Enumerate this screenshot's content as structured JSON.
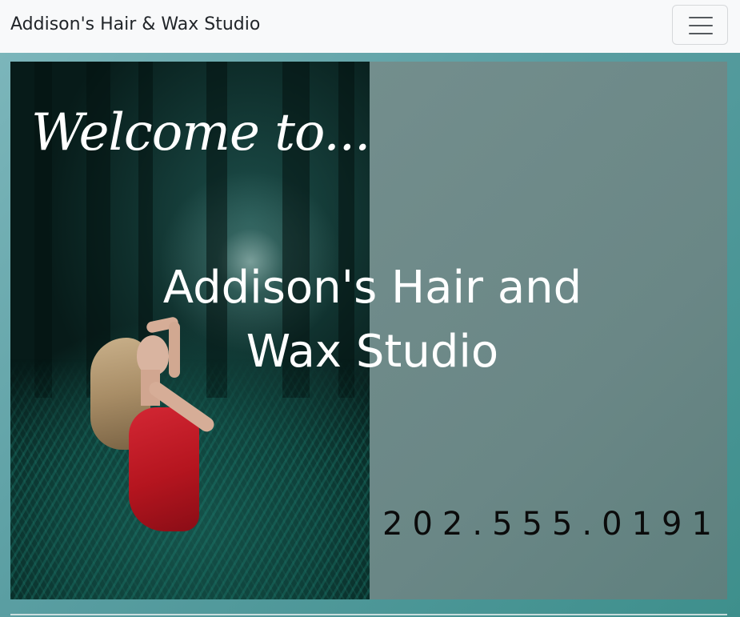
{
  "navbar": {
    "brand": "Addison's Hair & Wax Studio",
    "toggler_icon": "hamburger-menu-icon"
  },
  "hero": {
    "welcome": "Welcome to...",
    "title": "Addison's Hair and Wax Studio",
    "phone": "202.555.0191",
    "photo_description_icon": "woman-in-forest-photo"
  },
  "colors": {
    "navbar_bg": "#f8f9fa",
    "page_bg": "#5a9ea2",
    "overlay_bg": "#6e8a89",
    "title_text": "#ffffff",
    "phone_text": "#0b0b0b"
  }
}
